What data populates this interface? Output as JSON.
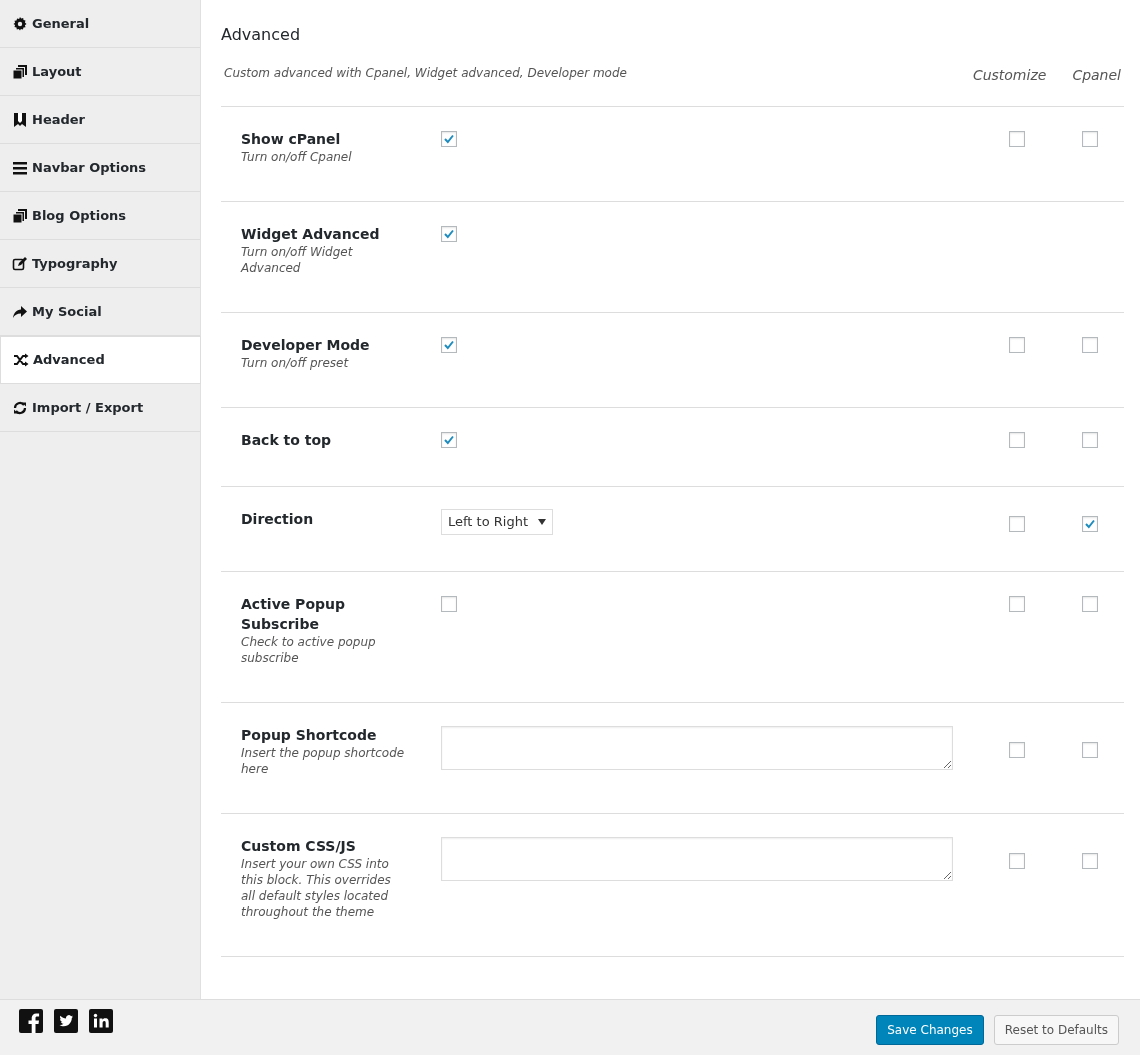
{
  "sidebar": {
    "items": [
      {
        "label": "General",
        "selected": false
      },
      {
        "label": "Layout",
        "selected": false
      },
      {
        "label": "Header",
        "selected": false
      },
      {
        "label": "Navbar Options",
        "selected": false
      },
      {
        "label": "Blog Options",
        "selected": false
      },
      {
        "label": "Typography",
        "selected": false
      },
      {
        "label": "My Social",
        "selected": false
      },
      {
        "label": "Advanced",
        "selected": true
      },
      {
        "label": "Import / Export",
        "selected": false
      }
    ]
  },
  "section": {
    "title": "Advanced",
    "description": "Custom advanced with Cpanel, Widget advanced, Developer mode",
    "columns": [
      "Customize",
      "Cpanel"
    ]
  },
  "rows": [
    {
      "kind": "checkbox",
      "title": "Show cPanel",
      "description": "Turn on/off Cpanel",
      "checked": true,
      "customize": {
        "checked": false
      },
      "cpanel": {
        "checked": false
      }
    },
    {
      "kind": "checkbox",
      "title": "Widget Advanced",
      "description": "Turn on/off Widget Advanced",
      "checked": true
    },
    {
      "kind": "checkbox",
      "title": "Developer Mode",
      "description": "Turn on/off preset",
      "checked": true,
      "customize": {
        "checked": false
      },
      "cpanel": {
        "checked": false
      }
    },
    {
      "kind": "checkbox",
      "title": "Back to top",
      "checked": true,
      "customize": {
        "checked": false
      },
      "cpanel": {
        "checked": false
      }
    },
    {
      "kind": "select",
      "title": "Direction",
      "value": "Left to Right",
      "customize": {
        "checked": false
      },
      "cpanel": {
        "checked": true
      }
    },
    {
      "kind": "checkbox",
      "title": "Active Popup Subscribe",
      "description": "Check to active popup subscribe",
      "checked": false,
      "customize": {
        "checked": false
      },
      "cpanel": {
        "checked": false
      }
    },
    {
      "kind": "textarea",
      "title": "Popup Shortcode",
      "description": "Insert the popup shortcode here",
      "customize": {
        "checked": false
      },
      "cpanel": {
        "checked": false
      }
    },
    {
      "kind": "textarea",
      "title": "Custom CSS/JS",
      "description": "Insert your own CSS into this block. This overrides all default styles located throughout the theme",
      "customize": {
        "checked": false
      },
      "cpanel": {
        "checked": false
      }
    }
  ],
  "footer": {
    "buttons": [
      {
        "label": "Save Changes",
        "kind": "primary"
      },
      {
        "label": "Reset to Defaults",
        "kind": "secondary"
      }
    ]
  }
}
